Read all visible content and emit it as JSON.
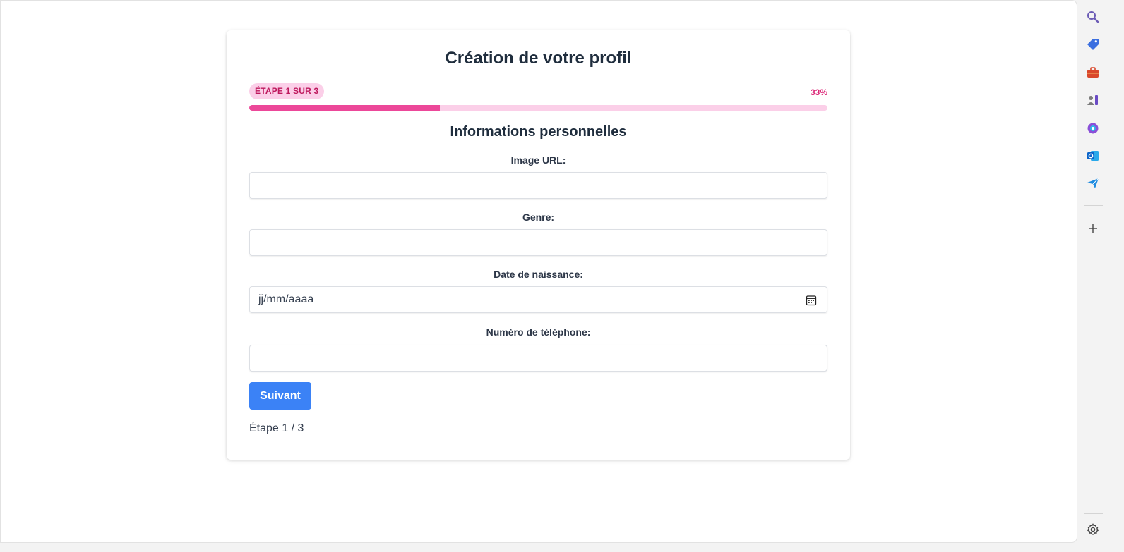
{
  "form": {
    "title": "Création de votre profil",
    "step_badge": "ÉTAPE 1 SUR 3",
    "percent_label": "33%",
    "progress_fraction": 0.33,
    "section_title": "Informations personnelles",
    "fields": [
      {
        "label": "Image URL:",
        "value": "",
        "placeholder": ""
      },
      {
        "label": "Genre:",
        "value": "",
        "placeholder": ""
      },
      {
        "label": "Date de naissance:",
        "value": "",
        "placeholder": "jj/mm/aaaa"
      },
      {
        "label": "Numéro de téléphone:",
        "value": "",
        "placeholder": ""
      }
    ],
    "next_button": "Suivant",
    "step_footer": "Étape 1 / 3"
  },
  "sidebar": {
    "icons": [
      "search-icon",
      "tag-icon",
      "toolbox-icon",
      "games-icon",
      "copilot-icon",
      "outlook-icon",
      "send-icon",
      "add-icon",
      "settings-icon"
    ]
  },
  "colors": {
    "accent_pink": "#ec4899",
    "pink_light": "#fbcfe8",
    "button_blue": "#3b82f6",
    "heading": "#1f2d3d"
  }
}
